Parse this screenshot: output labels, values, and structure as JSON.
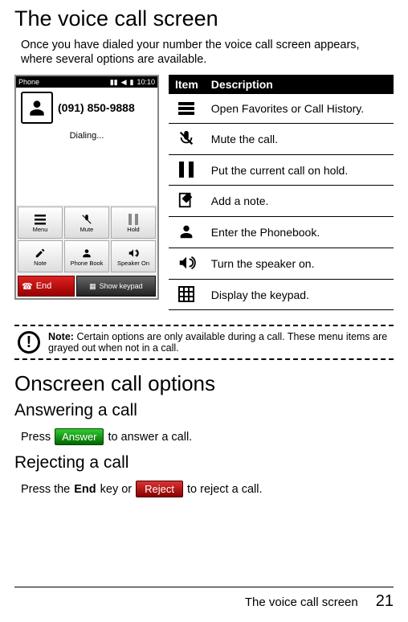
{
  "title": "The voice call screen",
  "intro": "Once you have dialed your number the voice call screen appears, where several options are available.",
  "screenshot": {
    "status_left": "Phone",
    "status_time": "10:10",
    "number": "(091) 850-9888",
    "dialing": "Dialing...",
    "buttons": [
      "Menu",
      "Mute",
      "Hold",
      "Note",
      "Phone Book",
      "Speaker On"
    ],
    "end": "End",
    "keypad": "Show keypad"
  },
  "table": {
    "head_item": "Item",
    "head_desc": "Description",
    "rows": [
      {
        "icon": "menu",
        "desc": "Open Favorites or Call History."
      },
      {
        "icon": "mute",
        "desc": "Mute the call."
      },
      {
        "icon": "hold",
        "desc": "Put the current call on hold."
      },
      {
        "icon": "note",
        "desc": "Add a note."
      },
      {
        "icon": "phonebook",
        "desc": "Enter the Phonebook."
      },
      {
        "icon": "speaker",
        "desc": "Turn the speaker on."
      },
      {
        "icon": "keypad",
        "desc": "Display the keypad."
      }
    ]
  },
  "note_label": "Note:",
  "note_text": "Certain options are only available during a call. These menu items are grayed out when not in a call.",
  "h2": "Onscreen call options",
  "answer_h": "Answering a call",
  "answer_p1": "Press",
  "answer_btn": "Answer",
  "answer_p2": "to answer a call.",
  "reject_h": "Rejecting a call",
  "reject_p1": "Press the",
  "reject_end": "End",
  "reject_p2": "key or",
  "reject_btn": "Reject",
  "reject_p3": "to reject a call.",
  "footer_title": "The voice call screen",
  "footer_page": "21"
}
